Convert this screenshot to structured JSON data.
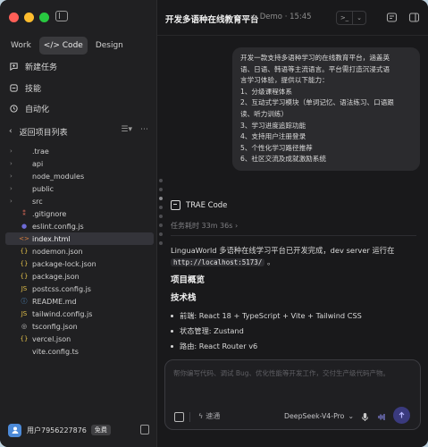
{
  "sidebar": {
    "modes": [
      {
        "label": "Work",
        "active": false
      },
      {
        "label": "</> Code",
        "active": true
      },
      {
        "label": "Design",
        "active": false
      }
    ],
    "nav": [
      {
        "label": "新建任务",
        "icon": "chat-plus-icon"
      },
      {
        "label": "技能",
        "icon": "skill-icon"
      },
      {
        "label": "自动化",
        "icon": "automation-icon"
      }
    ],
    "back_label": "返回项目列表",
    "tree": [
      {
        "name": ".trae",
        "type": "folder",
        "icon": "",
        "color": ""
      },
      {
        "name": "api",
        "type": "folder",
        "icon": "",
        "color": ""
      },
      {
        "name": "node_modules",
        "type": "folder",
        "icon": "",
        "color": ""
      },
      {
        "name": "public",
        "type": "folder",
        "icon": "",
        "color": ""
      },
      {
        "name": "src",
        "type": "folder",
        "icon": "",
        "color": ""
      },
      {
        "name": ".gitignore",
        "type": "file",
        "icon": "⁑",
        "color": "#e06c5c"
      },
      {
        "name": "eslint.config.js",
        "type": "file",
        "icon": "●",
        "color": "#6e6bd6"
      },
      {
        "name": "index.html",
        "type": "file",
        "icon": "<>",
        "color": "#e0823d"
      },
      {
        "name": "nodemon.json",
        "type": "file",
        "icon": "{}",
        "color": "#e3c14a"
      },
      {
        "name": "package-lock.json",
        "type": "file",
        "icon": "{}",
        "color": "#e3c14a"
      },
      {
        "name": "package.json",
        "type": "file",
        "icon": "{}",
        "color": "#e3c14a"
      },
      {
        "name": "postcss.config.js",
        "type": "file",
        "icon": "JS",
        "color": "#e3c14a"
      },
      {
        "name": "README.md",
        "type": "file",
        "icon": "ⓘ",
        "color": "#5aa0e0"
      },
      {
        "name": "tailwind.config.js",
        "type": "file",
        "icon": "JS",
        "color": "#e3c14a"
      },
      {
        "name": "tsconfig.json",
        "type": "file",
        "icon": "◎",
        "color": "#c5c5c5"
      },
      {
        "name": "vercel.json",
        "type": "file",
        "icon": "{}",
        "color": "#e3c14a"
      },
      {
        "name": "vite.config.ts",
        "type": "file",
        "icon": "",
        "color": ""
      }
    ],
    "selected_file": "index.html",
    "user": {
      "name": "用户7956227876",
      "badge": "免费"
    }
  },
  "header": {
    "title": "开发多语种在线教育平台",
    "meta": "Demo · 15:45"
  },
  "conversation": {
    "user_message": [
      "开发一款支持多语种学习的在线教育平台，涵盖英",
      "语、日语、韩语等主流语言。平台需打造沉浸式语",
      "言学习体验，提供以下能力：",
      "1、分级课程体系",
      "2、互动式学习模块（单词记忆、语法练习、口语跟",
      "读、听力训练）",
      "3、学习进度追踪功能",
      "4、支持用户注册登录",
      "5、个性化学习路径推荐",
      "6、社区交流及成就激励系统"
    ],
    "agent_name": "TRAE Code",
    "elapsed": "任务耗时 33m 36s",
    "summary_text": "LinguaWorld 多语种在线学习平台已开发完成，dev server 运行在",
    "server_url": "http://localhost:5173/",
    "summary_end": "。",
    "section_overview": "项目概览",
    "section_stack": "技术栈",
    "stack": [
      {
        "key": "前端",
        "value": "React 18 + TypeScript + Vite + Tailwind CSS"
      },
      {
        "key": "状态管理",
        "value": "Zustand"
      },
      {
        "key": "路由",
        "value": "React Router v6"
      }
    ]
  },
  "input": {
    "placeholder": "帮你编写代码、调试 Bug、优化性能等开发工作，交付生产级代码产物。",
    "quick_label": "速通",
    "model": "DeepSeek-V4-Pro"
  },
  "colors": {
    "accent_send": "#3a3a7e",
    "avatar": "#4c8ad8"
  }
}
